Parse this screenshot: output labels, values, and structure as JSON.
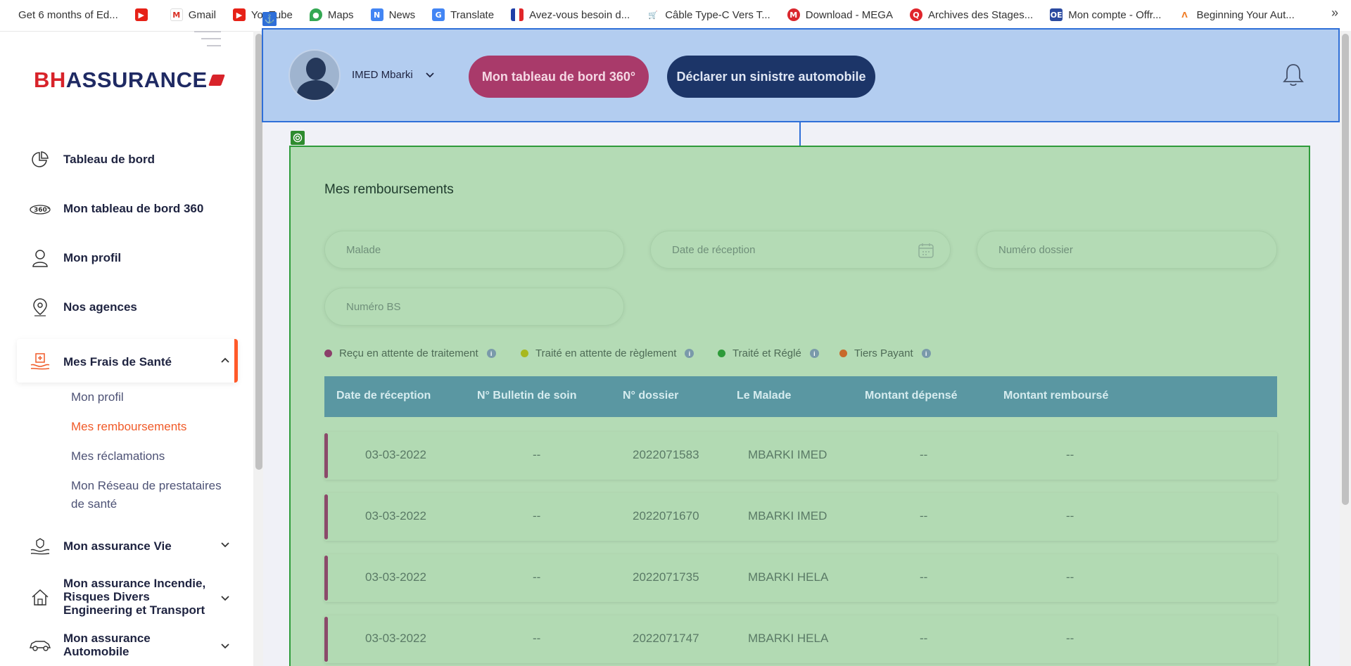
{
  "bookmarks": [
    {
      "label": "Get 6 months of Ed...",
      "icon": "none"
    },
    {
      "label": "",
      "icon": "youtube-icon"
    },
    {
      "label": "Gmail",
      "icon": "gmail-icon"
    },
    {
      "label": "YouTube",
      "icon": "youtube-icon"
    },
    {
      "label": "Maps",
      "icon": "maps-icon"
    },
    {
      "label": "News",
      "icon": "news-icon"
    },
    {
      "label": "Translate",
      "icon": "translate-icon"
    },
    {
      "label": "Avez-vous besoin d...",
      "icon": "flag-icon"
    },
    {
      "label": "Câble Type-C Vers T...",
      "icon": "cart-icon"
    },
    {
      "label": "Download - MEGA",
      "icon": "mega-icon"
    },
    {
      "label": "Archives des Stages...",
      "icon": "search-icon"
    },
    {
      "label": "Mon compte - Offr...",
      "icon": "oe-icon"
    },
    {
      "label": "Beginning Your Aut...",
      "icon": "arc-icon"
    }
  ],
  "bookmarks_more": "»",
  "sidebar": {
    "logo": {
      "bh": "BH",
      "rest": "ASSURANCE"
    },
    "items": [
      {
        "label": "Tableau de bord",
        "icon": "pie-chart-icon"
      },
      {
        "label": "Mon tableau de bord 360",
        "icon": "360-icon"
      },
      {
        "label": "Mon profil",
        "icon": "user-icon"
      },
      {
        "label": "Nos agences",
        "icon": "location-pin-icon"
      },
      {
        "label": "Mes Frais de Santé",
        "icon": "health-hands-icon"
      },
      {
        "label": "Mon assurance Vie",
        "icon": "life-hands-icon"
      },
      {
        "label": "Mon assurance Incendie, Risques Divers Engineering et Transport",
        "icon": "house-icon"
      },
      {
        "label": "Mon assurance Automobile",
        "icon": "car-icon"
      }
    ],
    "subitems": [
      {
        "label": "Mon profil"
      },
      {
        "label": "Mes remboursements"
      },
      {
        "label": "Mes réclamations"
      },
      {
        "label": "Mon Réseau de prestataires de santé"
      }
    ]
  },
  "header": {
    "user_name": "IMED Mbarki",
    "btn_360": "Mon tableau de bord 360°",
    "btn_sinistre": "Déclarer un sinistre automobile"
  },
  "main": {
    "title": "Mes remboursements",
    "fields": {
      "malade": "Malade",
      "date_reception": "Date de réception",
      "numero_dossier": "Numéro dossier",
      "numero_bs": "Numéro BS"
    },
    "legend": [
      {
        "label": "Reçu en attente de traitement",
        "color": "#8b3f6a"
      },
      {
        "label": "Traité en attente de règlement",
        "color": "#a8b81e"
      },
      {
        "label": "Traité et Réglé",
        "color": "#2e9b3a"
      },
      {
        "label": "Tiers Payant",
        "color": "#c8692a"
      }
    ],
    "table": {
      "headers": [
        "Date de réception",
        "N° Bulletin de soin",
        "N° dossier",
        "Le Malade",
        "Montant dépensé",
        "Montant remboursé"
      ],
      "rows": [
        [
          "03-03-2022",
          "--",
          "2022071583",
          "MBARKI IMED",
          "--",
          "--"
        ],
        [
          "03-03-2022",
          "--",
          "2022071670",
          "MBARKI IMED",
          "--",
          "--"
        ],
        [
          "03-03-2022",
          "--",
          "2022071735",
          "MBARKI HELA",
          "--",
          "--"
        ],
        [
          "03-03-2022",
          "--",
          "2022071747",
          "MBARKI HELA",
          "--",
          "--"
        ]
      ]
    }
  }
}
